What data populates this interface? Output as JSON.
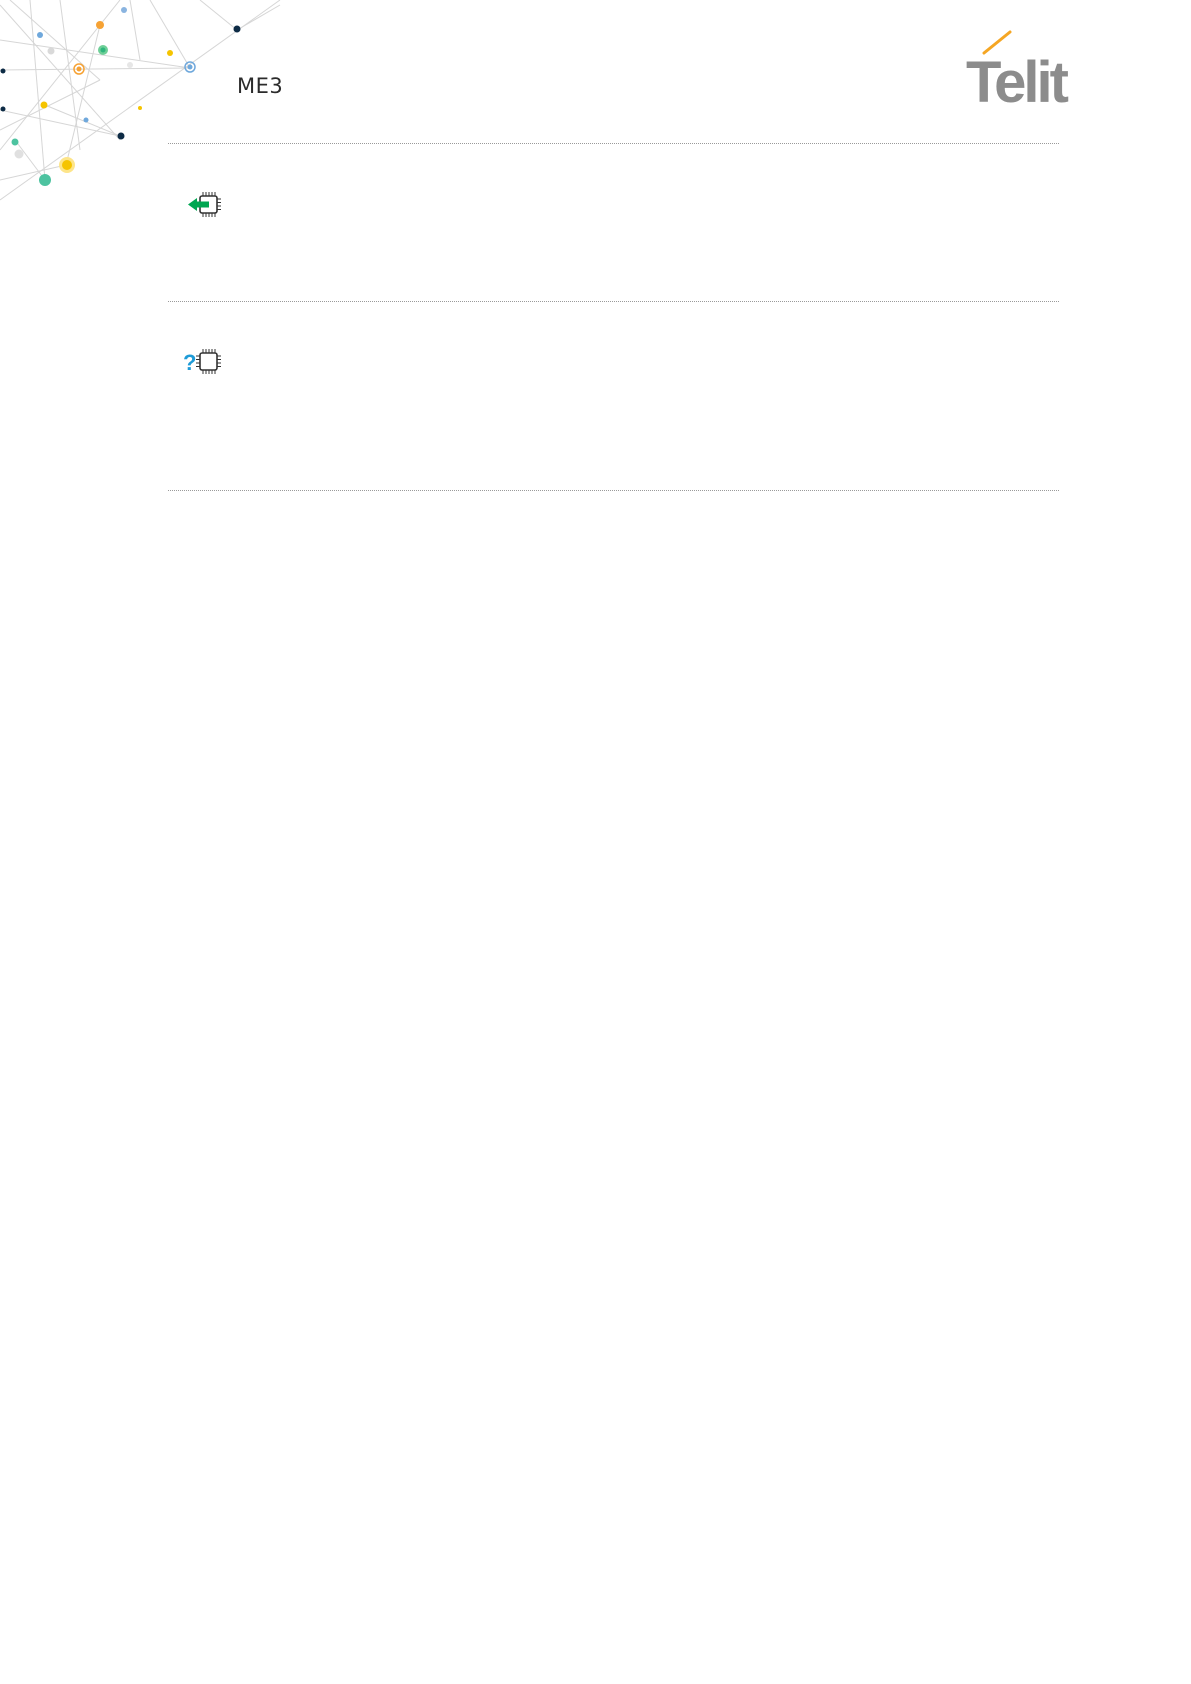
{
  "header": {
    "title": "ME3"
  },
  "logo": {
    "text": "Telit",
    "color": "#8c8c8c",
    "accent_color": "#f5a623"
  },
  "icons": {
    "set": "set-command-chip-icon",
    "read": "read-command-chip-icon"
  },
  "colors": {
    "set_arrow": "#00a651",
    "read_question": "#1e9bd7",
    "divider": "#9a9a9a"
  }
}
